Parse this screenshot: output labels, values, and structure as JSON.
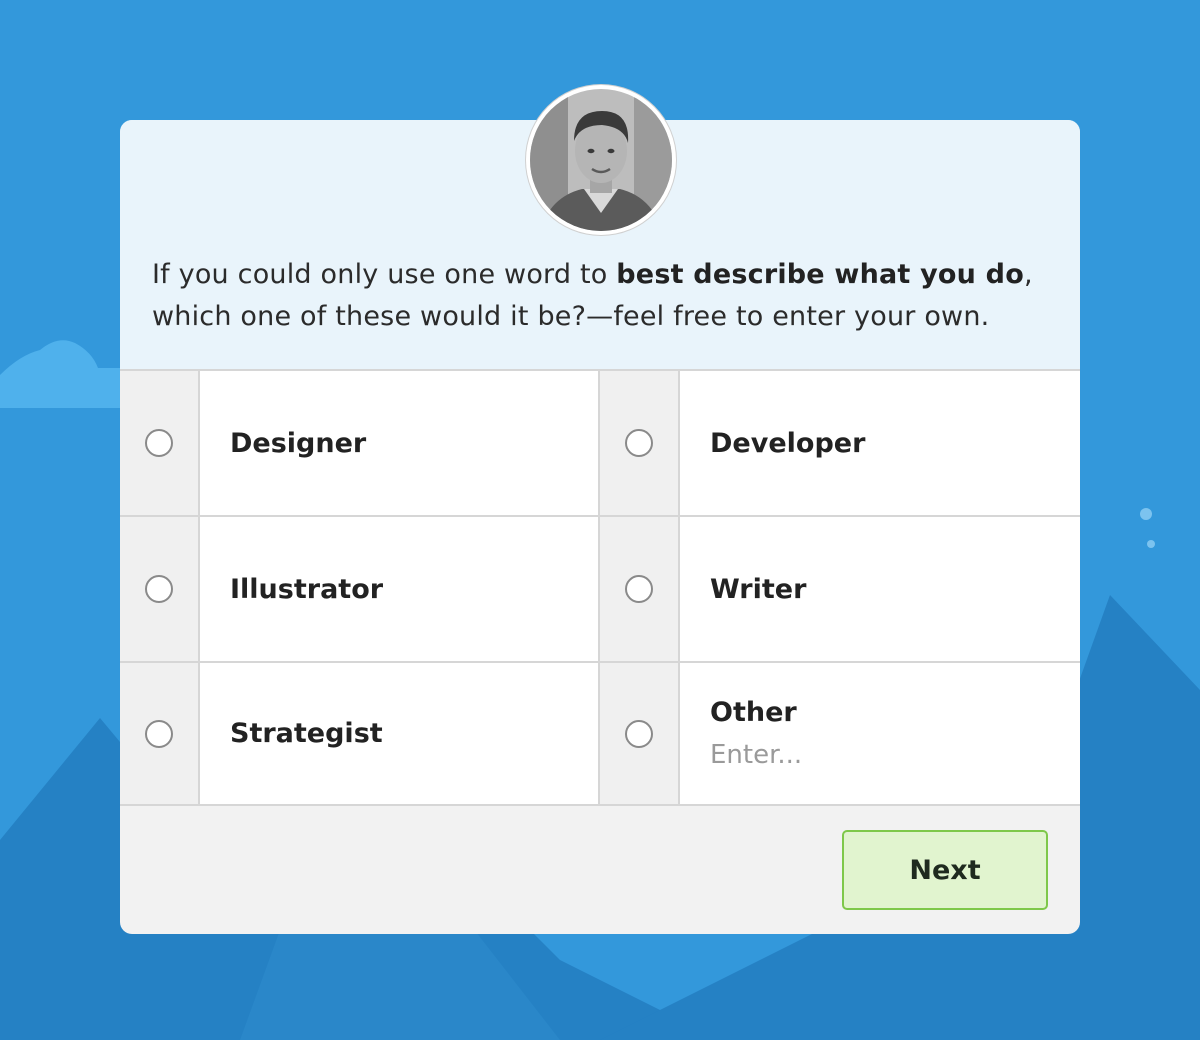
{
  "colors": {
    "background": "#3398db",
    "header_background": "#e9f4fb",
    "next_button_fill": "#e1f4cf",
    "next_button_border": "#7ec84a"
  },
  "question": {
    "before": "If you could only use one word to ",
    "bold": "best describe what you do",
    "after": ", which one of these would it be?—feel free to enter your own."
  },
  "options": [
    {
      "label": "Designer",
      "selected": false
    },
    {
      "label": "Developer",
      "selected": false
    },
    {
      "label": "Illustrator",
      "selected": false
    },
    {
      "label": "Writer",
      "selected": false
    },
    {
      "label": "Strategist",
      "selected": false
    },
    {
      "label": "Other",
      "selected": false,
      "input_placeholder": "Enter..."
    }
  ],
  "footer": {
    "next_label": "Next"
  },
  "avatar": {
    "icon": "user-avatar-photo"
  }
}
